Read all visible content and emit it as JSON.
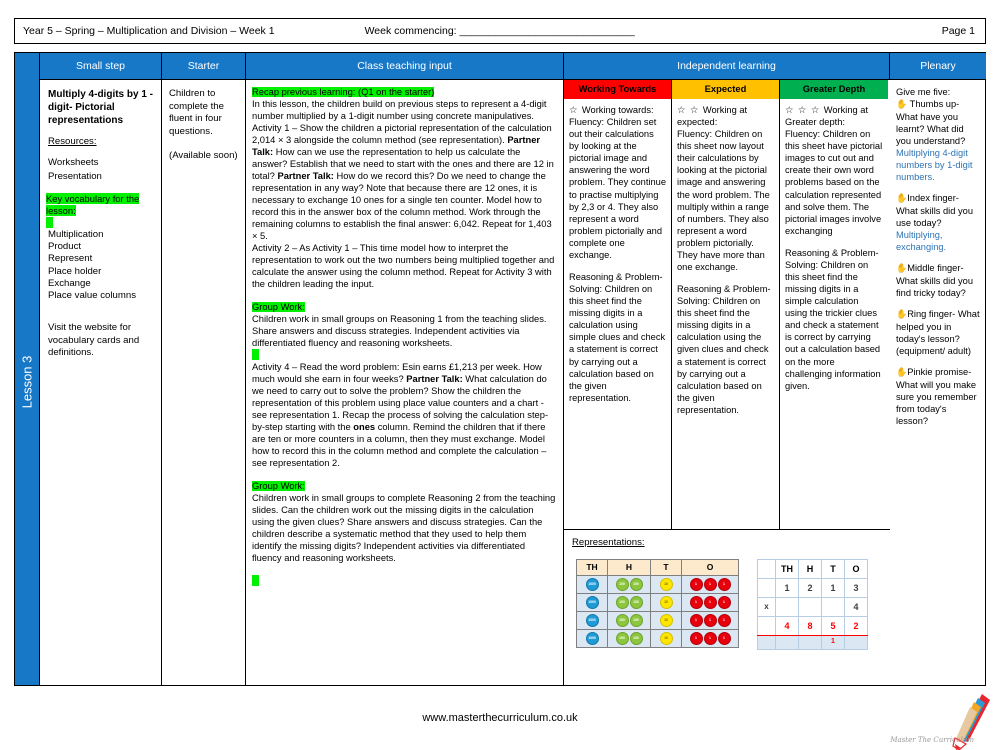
{
  "header": {
    "left": "Year 5 – Spring – Multiplication and Division – Week 1",
    "week_commencing_label": "Week commencing: ______________________________",
    "page": "Page 1"
  },
  "spine": {
    "lesson_label": "Lesson 3"
  },
  "columns": {
    "small_step": "Small step",
    "starter": "Starter",
    "class_teaching_input": "Class teaching input",
    "independent_learning": "Independent learning",
    "plenary": "Plenary"
  },
  "small_step": {
    "title": "Multiply 4-digits by 1 - digit- Pictorial representations",
    "resources_label": "Resources:",
    "resources": [
      "Worksheets",
      "Presentation"
    ],
    "key_vocab_heading": "Key vocabulary for the lesson:",
    "vocab": [
      "Multiplication",
      "Product",
      "Represent",
      "Place holder",
      "Exchange",
      "Place value columns"
    ],
    "visit": "Visit the website for vocabulary cards and definitions."
  },
  "starter": {
    "line1": "Children to complete the fluent in four questions.",
    "line2": "(Available soon)"
  },
  "class_teaching": {
    "recap_heading": "Recap previous learning: (Q1 on the starter)",
    "intro": "In this lesson, the children build on previous steps to represent a 4-digit number multiplied by a 1-digit number using concrete manipulatives.",
    "activity1_a": "Activity 1 – Show the children a pictorial representation of the calculation 2,014 × 3 alongside the column method (see representation). ",
    "partner_talk_1": "Partner Talk:",
    "activity1_b": " How can we use the representation to help us calculate the answer? Establish that we need to start with the ones and there are 12 in total? ",
    "partner_talk_2": "Partner Talk:",
    "activity1_c": " How do we record this? Do we need to change the representation in any way? Note that because there are 12 ones, it is necessary to exchange 10 ones for a single ten counter. Model how to record this in the answer box of the column method. Work through the remaining columns to establish the final answer: 6,042. Repeat for 1,403 × 5.",
    "activity2": "Activity 2 – As Activity 1 – This time model how to interpret the representation to work out the two numbers being multiplied together and calculate the answer using the column method. Repeat for Activity 3 with the children leading the input.",
    "group_work_1_heading": "Group Work:",
    "group_work_1": "Children work in small groups on Reasoning 1 from the teaching slides. Share answers and discuss strategies. Independent activities via differentiated fluency and reasoning worksheets.",
    "activity4_a": "Activity 4 – Read the word problem: Esin earns £1,213 per week. How much would she earn in four weeks? ",
    "partner_talk_3": "Partner Talk:",
    "activity4_b": " What calculation do we need to carry out to solve the problem? Show the children the representation of this problem using place value counters and a chart - see representation 1. Recap the process of solving the calculation step-by-step starting with the ",
    "ones_bold": "ones",
    "activity4_c": " column. Remind the children that if there are ten or more counters in a column, then they must exchange. Model how to record this in the column method and complete the calculation – see representation 2.",
    "group_work_2_heading": "Group Work:",
    "group_work_2": "Children work in small groups to complete Reasoning 2 from the teaching slides. Can the children work out the missing digits in the calculation using the given clues? Share answers and discuss strategies. Can the children describe a systematic method that they used to help them identify the missing digits? Independent activities via differentiated fluency and reasoning worksheets."
  },
  "independent": {
    "bands": [
      {
        "label": "Working Towards",
        "color": "#FF0000",
        "stars": "☆  ",
        "heading": "Working towards:",
        "fluency": "Fluency: Children set out their calculations by looking at the pictorial image and answering the word problem. They continue to practise multiplying by 2,3 or 4. They also represent a word problem pictorially and complete one exchange.",
        "reasoning": "Reasoning & Problem-Solving: Children on this sheet find the missing digits in a calculation using simple clues and check a statement is correct by carrying out a calculation based on the given representation."
      },
      {
        "label": "Expected",
        "color": "#FFC000",
        "stars": "☆ ☆  ",
        "heading": "Working at expected:",
        "fluency": "Fluency: Children on this sheet now layout their calculations by looking at the pictorial image and answering the word problem. The multiply within a range of numbers. They also represent a word problem pictorially. They have more than one exchange.",
        "reasoning": "Reasoning & Problem-Solving: Children on this sheet find the missing digits in a calculation using the given clues and check a statement is correct by carrying out a calculation based on the given representation."
      },
      {
        "label": "Greater Depth",
        "color": "#00B050",
        "stars": "☆ ☆ ☆  ",
        "heading": "Working at Greater depth:",
        "fluency": "Fluency: Children on this sheet have pictorial images to cut out and create their own word problems based on the calculation represented and solve them. The pictorial images involve exchanging",
        "reasoning": "Reasoning & Problem-Solving: Children on this sheet find the missing digits in a simple calculation using the trickier clues and check a statement is correct by carrying out a calculation based on the more challenging information given."
      }
    ],
    "representations_title": "Representations:",
    "pv_chart": {
      "headers": [
        "TH",
        "H",
        "T",
        "O"
      ],
      "rows": [
        {
          "TH": 1,
          "H": 2,
          "T": 1,
          "O": 3
        },
        {
          "TH": 1,
          "H": 2,
          "T": 1,
          "O": 3
        },
        {
          "TH": 1,
          "H": 2,
          "T": 1,
          "O": 3
        },
        {
          "TH": 1,
          "H": 2,
          "T": 1,
          "O": 3
        }
      ],
      "counter_labels": {
        "TH": "1000",
        "H": "100",
        "T": "10",
        "O": "1"
      }
    },
    "column_method": {
      "headers": [
        "",
        "TH",
        "H",
        "T",
        "O"
      ],
      "row_number": [
        "",
        "1",
        "2",
        "1",
        "3"
      ],
      "row_multiplier": [
        "x",
        "",
        "",
        "",
        "4"
      ],
      "row_answer": [
        "",
        "4",
        "8",
        "5",
        "2"
      ],
      "carry": "1"
    }
  },
  "plenary": {
    "title": "Give me five:",
    "items": [
      {
        "icon": "hand-icon",
        "q": "Thumbs up- What have you learnt? What did you understand?",
        "a": "Multiplying 4-digit numbers by 1-digit numbers."
      },
      {
        "icon": "hand-icon",
        "q": "Index finger- What skills did you use today?",
        "a": "Multiplying, exchanging."
      },
      {
        "icon": "hand-icon",
        "q": "Middle finger- What skills did you find tricky today?",
        "a": ""
      },
      {
        "icon": "hand-icon",
        "q": "Ring finger- What helped you in today's lesson? (equipment/ adult)",
        "a": ""
      },
      {
        "icon": "hand-icon",
        "q": "Pinkie promise- What will you make sure you remember from today's lesson?",
        "a": ""
      }
    ]
  },
  "footer": {
    "url": "www.masterthecurriculum.co.uk",
    "logo_text": "Master The Curriculum"
  }
}
